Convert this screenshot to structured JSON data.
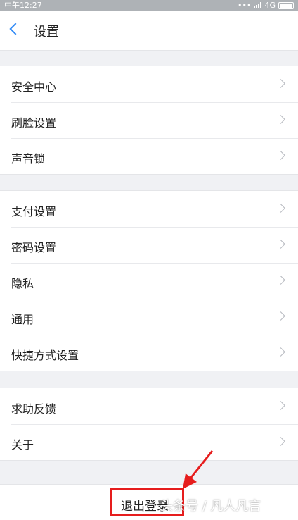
{
  "status_bar": {
    "time": "中午12:27",
    "network": "4G"
  },
  "nav": {
    "title": "设置",
    "back_icon": "chevron-left-icon"
  },
  "groups": [
    {
      "items": [
        {
          "label": "安全中心"
        },
        {
          "label": "刷脸设置"
        },
        {
          "label": "声音锁"
        }
      ]
    },
    {
      "items": [
        {
          "label": "支付设置"
        },
        {
          "label": "密码设置"
        },
        {
          "label": "隐私"
        },
        {
          "label": "通用"
        },
        {
          "label": "快捷方式设置"
        }
      ]
    },
    {
      "items": [
        {
          "label": "求助反馈"
        },
        {
          "label": "关于"
        }
      ]
    }
  ],
  "logout": {
    "label": "退出登录"
  },
  "watermark": "头条号 / 凡人凡言",
  "colors": {
    "accent": "#2f89f5",
    "highlight": "#e61d1d",
    "background": "#f0f1f4"
  }
}
